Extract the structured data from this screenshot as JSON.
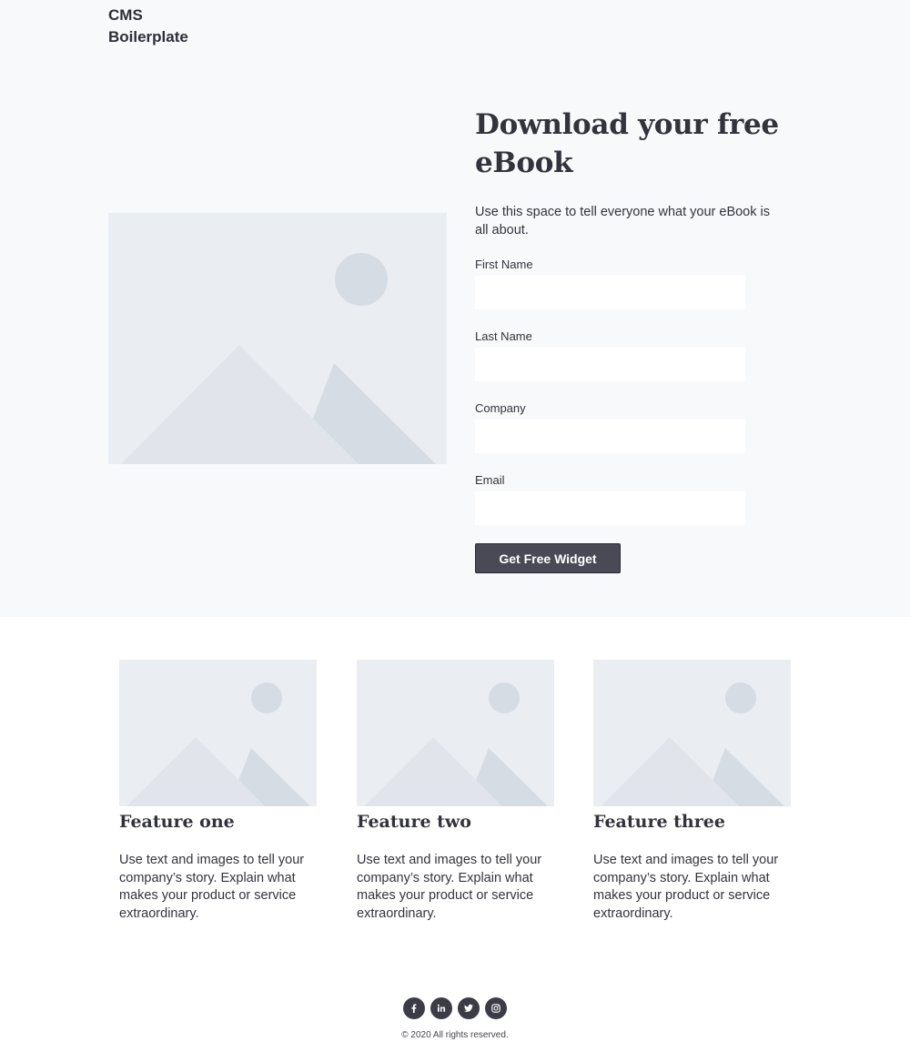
{
  "header": {
    "logo_line1": "CMS",
    "logo_line2": "Boilerplate"
  },
  "hero": {
    "headline": "Download your free eBook",
    "intro": "Use this space to tell everyone what your eBook is all about.",
    "image_icon": "placeholder-image-icon"
  },
  "form": {
    "fields": [
      {
        "label": "First Name",
        "value": "",
        "placeholder": ""
      },
      {
        "label": "Last Name",
        "value": "",
        "placeholder": ""
      },
      {
        "label": "Company",
        "value": "",
        "placeholder": ""
      },
      {
        "label": "Email",
        "value": "",
        "placeholder": ""
      }
    ],
    "submit_label": "Get Free Widget"
  },
  "features": [
    {
      "title": "Feature one",
      "text": "Use text and images to tell your company’s story. Explain what makes your product or service extraordinary."
    },
    {
      "title": "Feature two",
      "text": "Use text and images to tell your company’s story. Explain what makes your product or service extraordinary."
    },
    {
      "title": "Feature three",
      "text": "Use text and images to tell your company’s story. Explain what makes your product or service extraordinary."
    }
  ],
  "footer": {
    "social_icons": [
      "facebook-icon",
      "linkedin-icon",
      "twitter-icon",
      "instagram-icon"
    ],
    "copyright": "© 2020 All rights reserved."
  },
  "colors": {
    "hero_background": "#f8f9fb",
    "button_background": "#4a4a56",
    "placeholder_background": "#eaedf2",
    "placeholder_shape": "#d6dce4",
    "text": "#33333d"
  }
}
